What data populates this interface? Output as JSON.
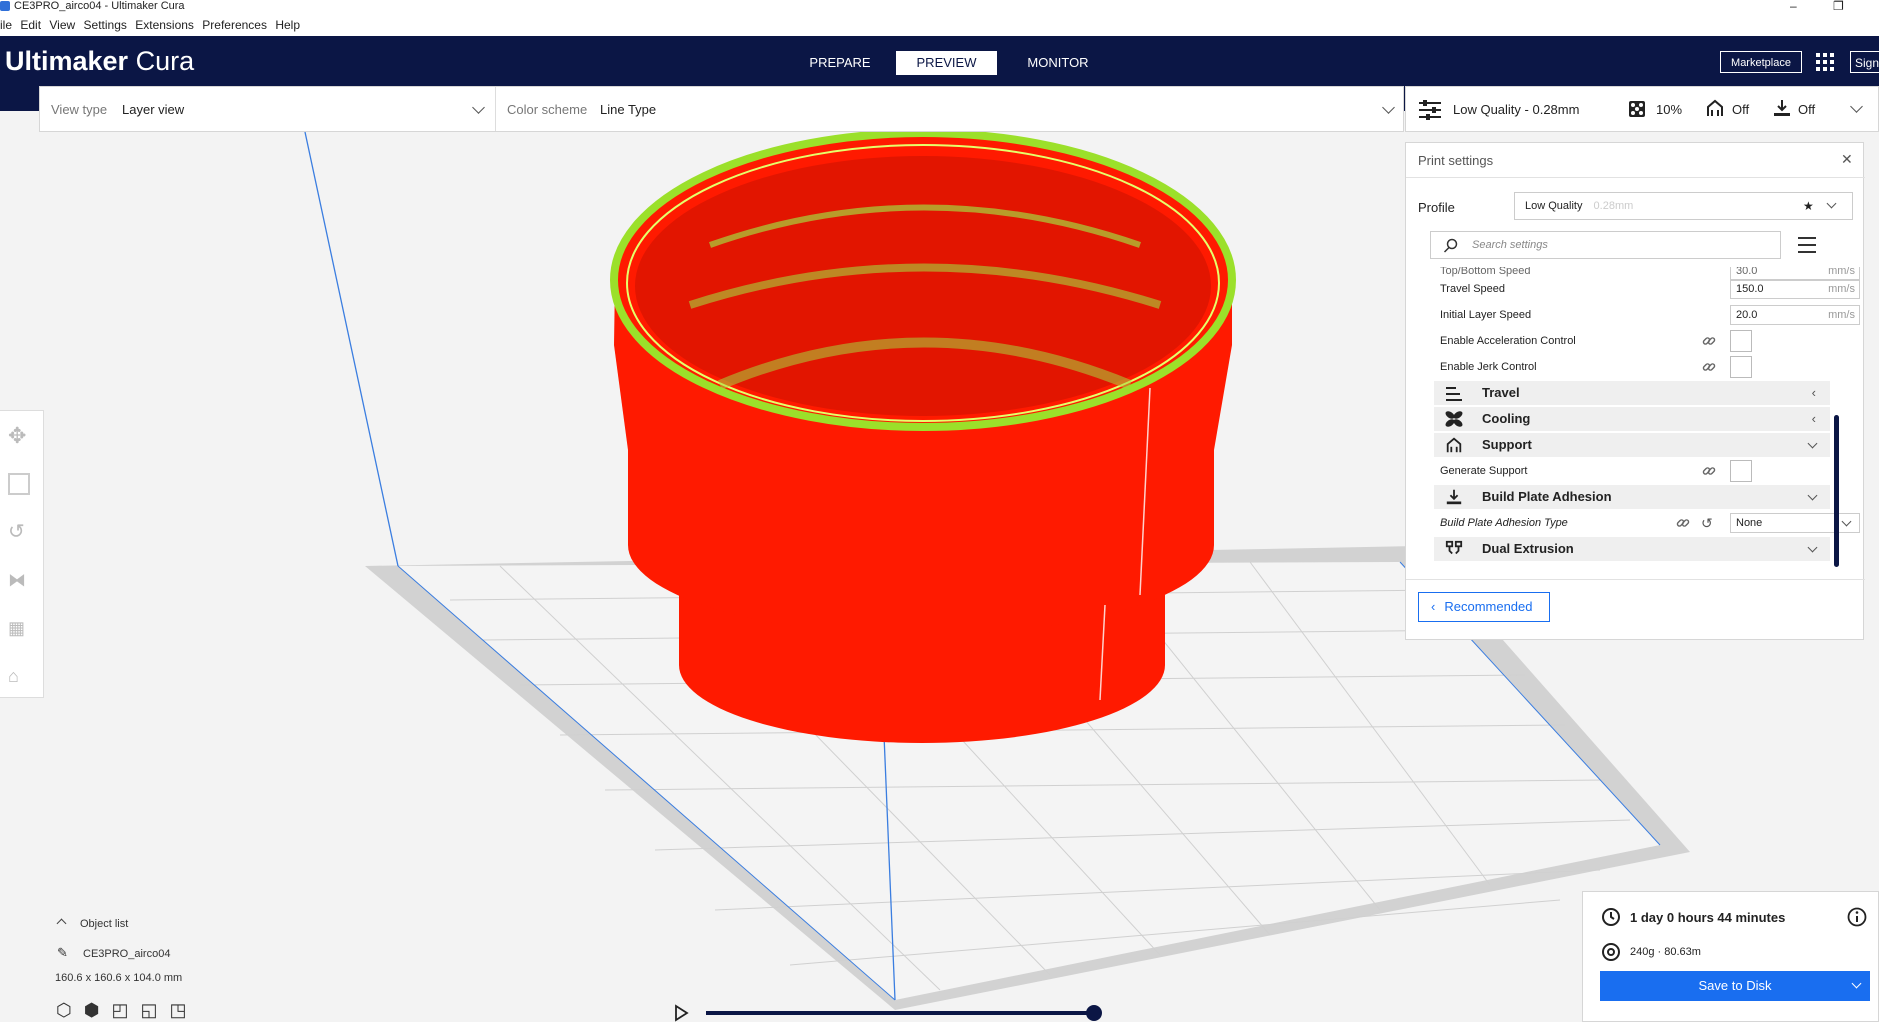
{
  "window": {
    "title": "CE3PRO_airco04 - Ultimaker Cura"
  },
  "menu": [
    "ile",
    "Edit",
    "View",
    "Settings",
    "Extensions",
    "Preferences",
    "Help"
  ],
  "header": {
    "brand_bold": "Ultimaker",
    "brand_light": " Cura",
    "tabs": [
      "PREPARE",
      "PREVIEW",
      "MONITOR"
    ],
    "active_tab": "PREVIEW",
    "marketplace": "Marketplace",
    "signin": "Sign"
  },
  "viewbar": {
    "view_type_label": "View type",
    "view_type_value": "Layer view",
    "color_scheme_label": "Color scheme",
    "color_scheme_value": "Line Type"
  },
  "printbar": {
    "profile": "Low Quality - 0.28mm",
    "infill": "10%",
    "support": "Off",
    "adhesion": "Off"
  },
  "panel": {
    "title": "Print settings",
    "profile_label": "Profile",
    "profile_value": "Low Quality",
    "profile_sub": "0.28mm",
    "search_placeholder": "Search settings",
    "partial_row": "Top/Bottom Speed",
    "partial_value": "30.0",
    "rows": [
      {
        "label": "Travel Speed",
        "value": "150.0",
        "unit": "mm/s"
      },
      {
        "label": "Initial Layer Speed",
        "value": "20.0",
        "unit": "mm/s"
      },
      {
        "label": "Enable Acceleration Control"
      },
      {
        "label": "Enable Jerk Control"
      }
    ],
    "categories": [
      {
        "label": "Travel",
        "icon": "travel-icon",
        "state": "collapsed"
      },
      {
        "label": "Cooling",
        "icon": "cooling-icon",
        "state": "collapsed"
      },
      {
        "label": "Support",
        "icon": "support-icon",
        "state": "expanded"
      },
      {
        "label": "Build Plate Adhesion",
        "icon": "adhesion-icon",
        "state": "expanded"
      },
      {
        "label": "Dual Extrusion",
        "icon": "dual-extrusion-icon",
        "state": "expanded"
      }
    ],
    "generate_support": "Generate Support",
    "adhesion_type_label": "Build Plate Adhesion Type",
    "adhesion_type_value": "None",
    "recommended": "Recommended"
  },
  "job": {
    "time": "1 day 0 hours 44 minutes",
    "material": "240g · 80.63m",
    "save": "Save to Disk"
  },
  "objects": {
    "header": "Object list",
    "name": "CE3PRO_airco04",
    "dims": "160.6 x 160.6 x 104.0 mm"
  },
  "colors": {
    "header": "#0b1645",
    "accent": "#196ef0",
    "model": "#ff1a00",
    "edge": "#9be02a"
  }
}
